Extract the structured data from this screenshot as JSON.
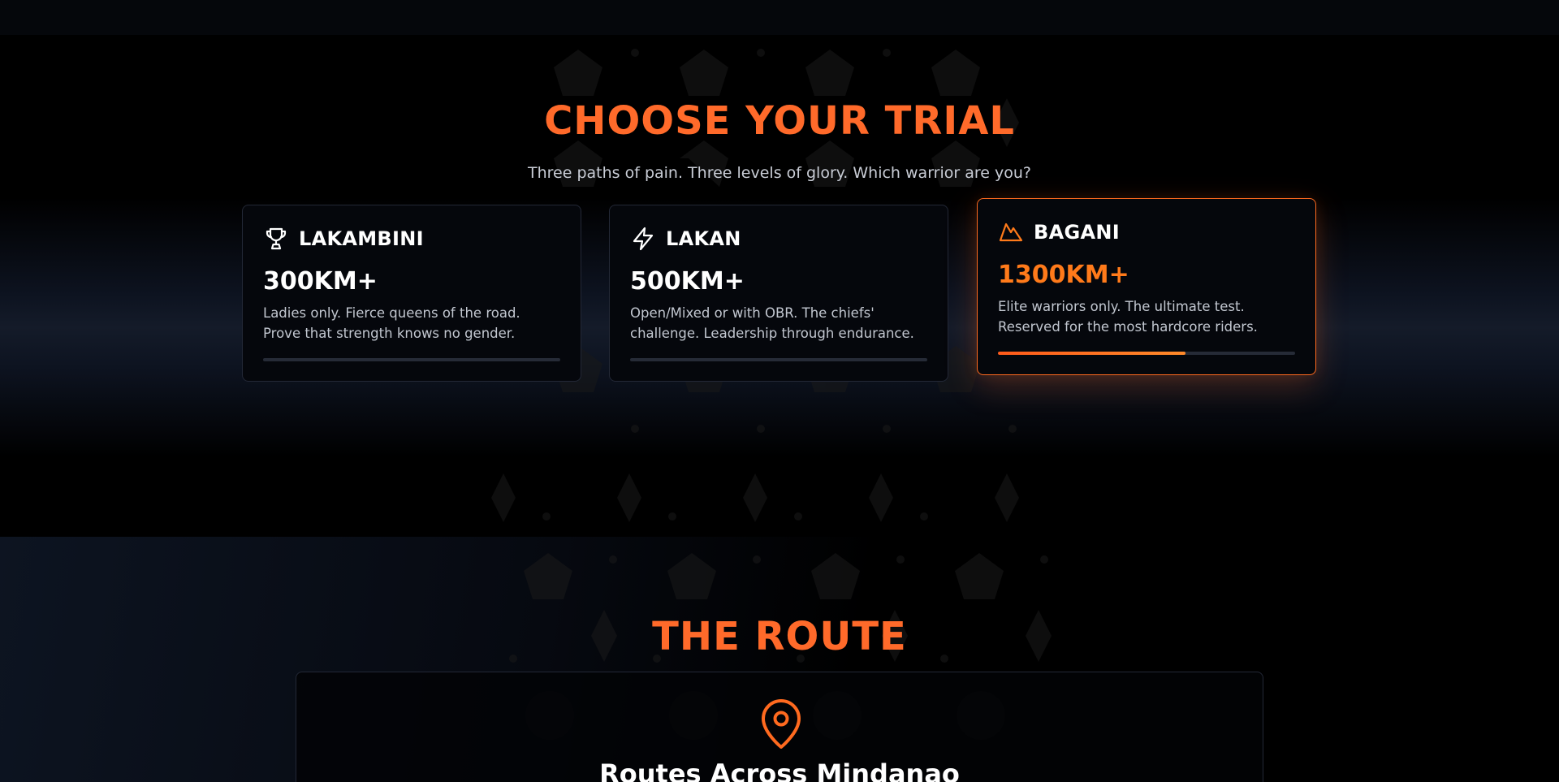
{
  "trials_section": {
    "title": "CHOOSE YOUR TRIAL",
    "subtitle": "Three paths of pain. Three levels of glory. Which warrior are you?",
    "cards": [
      {
        "icon": "trophy-icon",
        "name": "LAKAMBINI",
        "distance": "300KM+",
        "description": "Ladies only. Fierce queens of the road. Prove that strength knows no gender.",
        "progress": 0,
        "highlighted": false
      },
      {
        "icon": "lightning-icon",
        "name": "LAKAN",
        "distance": "500KM+",
        "description": "Open/Mixed or with OBR. The chiefs' challenge. Leadership through endurance.",
        "progress": 0,
        "highlighted": false
      },
      {
        "icon": "mountain-icon",
        "name": "BAGANI",
        "distance": "1300KM+",
        "description": "Elite warriors only. The ultimate test. Reserved for the most hardcore riders.",
        "progress": 0.63,
        "highlighted": true
      }
    ]
  },
  "route_section": {
    "title": "THE ROUTE",
    "icon": "map-pin-icon",
    "heading": "Routes Across Mindanao"
  },
  "colors": {
    "accent": "#ff6a2a",
    "accent_highlight": "#ff7a1a",
    "card_border": "#232836",
    "text_muted": "#c2c7d0"
  }
}
